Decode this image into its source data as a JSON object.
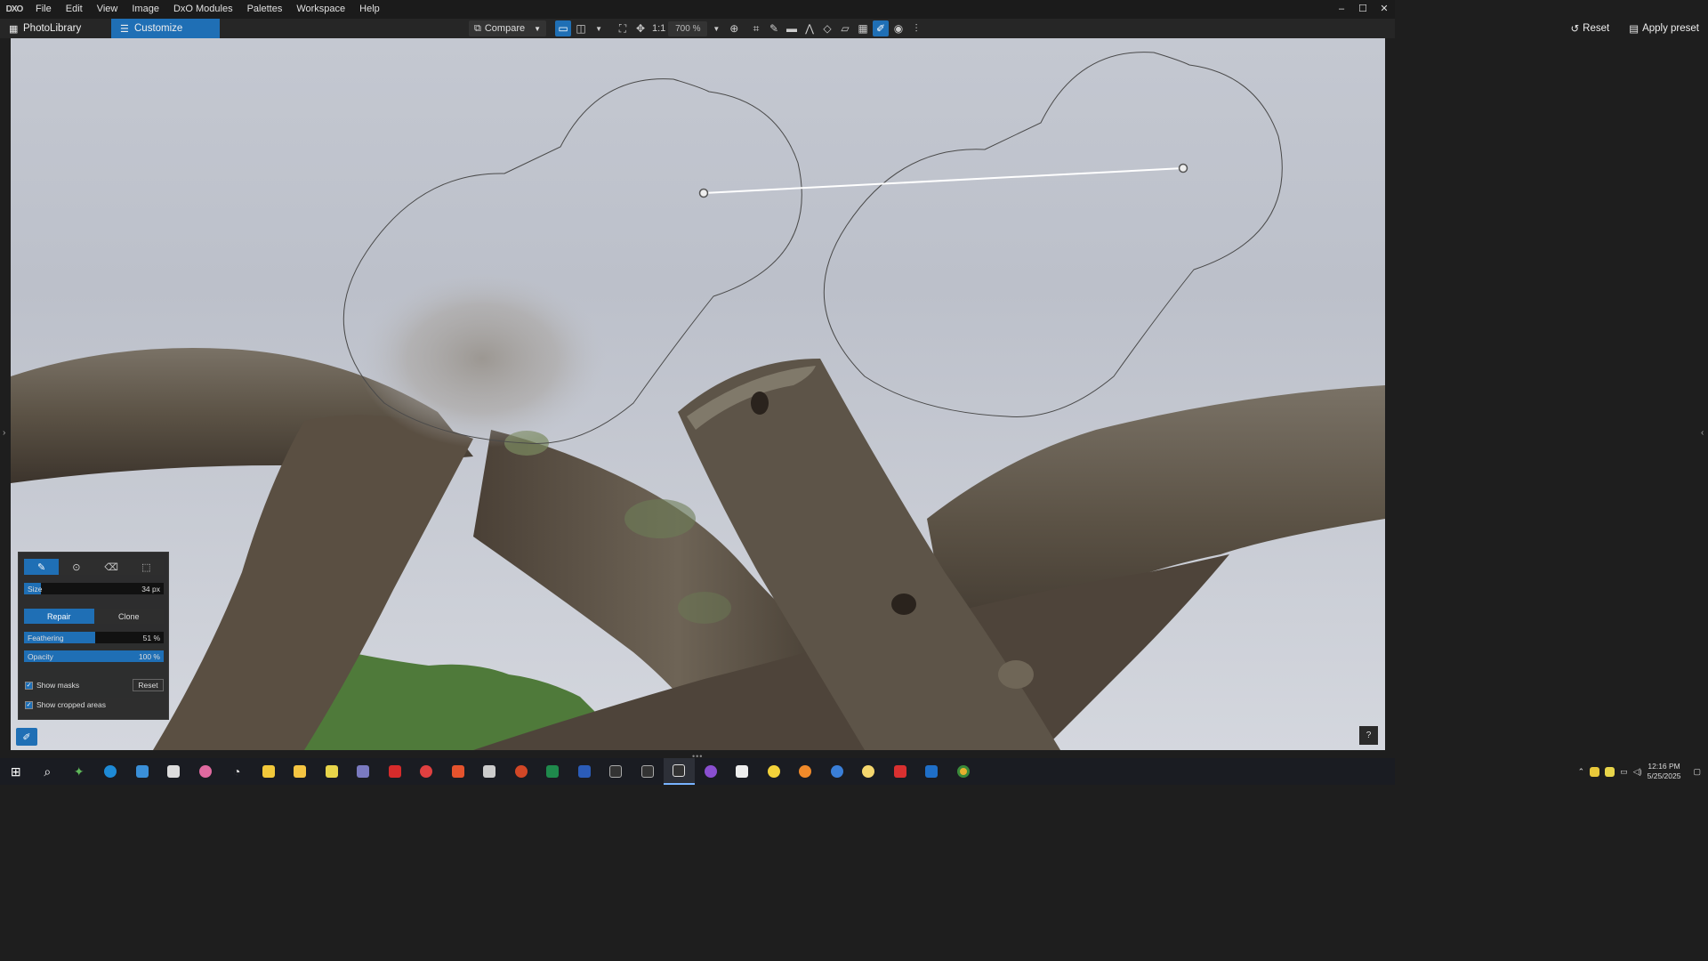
{
  "app": {
    "logo_text": "DXO",
    "menu": [
      "File",
      "Edit",
      "View",
      "Image",
      "DxO Modules",
      "Palettes",
      "Workspace",
      "Help"
    ],
    "window_controls": {
      "minimize": "–",
      "maximize": "☐",
      "close": "✕"
    }
  },
  "tabs": {
    "photolibrary": "PhotoLibrary",
    "customize": "Customize"
  },
  "toolbar": {
    "compare_label": "Compare",
    "one_to_one": "1:1",
    "zoom_value": "700 %",
    "reset_label": "Reset",
    "apply_preset_label": "Apply preset"
  },
  "repair_panel": {
    "size_label": "Size",
    "size_value": "34 px",
    "size_fill": 0.12,
    "repair_label": "Repair",
    "clone_label": "Clone",
    "feathering_label": "Feathering",
    "feathering_value": "51 %",
    "feathering_fill": 0.51,
    "opacity_label": "Opacity",
    "opacity_value": "100 %",
    "opacity_fill": 1.0,
    "show_masks_label": "Show masks",
    "show_masks_checked": true,
    "reset_label": "Reset",
    "show_cropped_label": "Show cropped areas",
    "show_cropped_checked": true
  },
  "canvas": {
    "help_label": "?"
  },
  "taskbar": {
    "time": "12:16 PM",
    "date": "5/25/2025"
  },
  "colors": {
    "accent": "#1f6fb5",
    "background": "#1e1e1e"
  }
}
